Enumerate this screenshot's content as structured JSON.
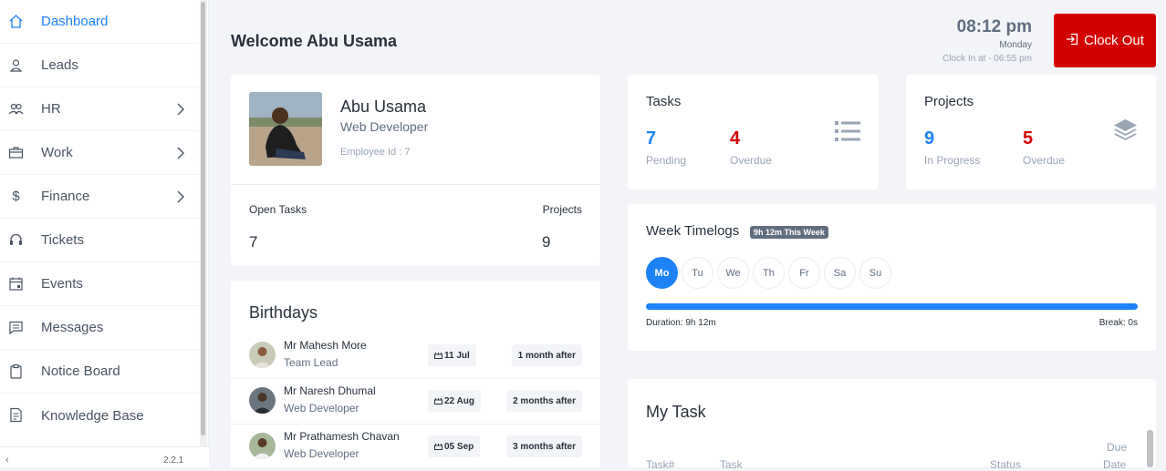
{
  "sidebar": {
    "items": [
      {
        "label": "Dashboard",
        "icon": "home-icon",
        "active": true,
        "chevron": false
      },
      {
        "label": "Leads",
        "icon": "user-icon",
        "active": false,
        "chevron": false
      },
      {
        "label": "HR",
        "icon": "users-icon",
        "active": false,
        "chevron": true
      },
      {
        "label": "Work",
        "icon": "briefcase-icon",
        "active": false,
        "chevron": true
      },
      {
        "label": "Finance",
        "icon": "dollar-icon",
        "active": false,
        "chevron": true
      },
      {
        "label": "Tickets",
        "icon": "headset-icon",
        "active": false,
        "chevron": false
      },
      {
        "label": "Events",
        "icon": "calendar-icon",
        "active": false,
        "chevron": false
      },
      {
        "label": "Messages",
        "icon": "message-icon",
        "active": false,
        "chevron": false
      },
      {
        "label": "Notice Board",
        "icon": "clipboard-icon",
        "active": false,
        "chevron": false
      },
      {
        "label": "Knowledge Base",
        "icon": "document-icon",
        "active": false,
        "chevron": false
      }
    ],
    "collapse_arrow": "‹",
    "version": "2.2.1"
  },
  "header": {
    "welcome": "Welcome Abu Usama",
    "time": "08:12 pm",
    "day": "Monday",
    "clock_in": "Clock In at - 06:55 pm",
    "clock_out_label": "Clock Out"
  },
  "profile": {
    "name": "Abu Usama",
    "role": "Web Developer",
    "employee_id": "Employee Id : 7",
    "open_tasks_label": "Open Tasks",
    "open_tasks": "7",
    "projects_label": "Projects",
    "projects": "9"
  },
  "tasks": {
    "title": "Tasks",
    "pending": "7",
    "pending_label": "Pending",
    "overdue": "4",
    "overdue_label": "Overdue"
  },
  "projects": {
    "title": "Projects",
    "in_progress": "9",
    "in_progress_label": "In Progress",
    "overdue": "5",
    "overdue_label": "Overdue"
  },
  "timelogs": {
    "title": "Week Timelogs",
    "badge": "9h 12m This Week",
    "days": [
      "Mo",
      "Tu",
      "We",
      "Th",
      "Fr",
      "Sa",
      "Su"
    ],
    "duration": "Duration: 9h 12m",
    "break": "Break: 0s",
    "progress": 1.0
  },
  "birthdays": {
    "title": "Birthdays",
    "rows": [
      {
        "name": "Mr Mahesh More",
        "role": "Team Lead",
        "date": "11 Jul",
        "after": "1 month after"
      },
      {
        "name": "Mr Naresh Dhumal",
        "role": "Web Developer",
        "date": "22 Aug",
        "after": "2 months after"
      },
      {
        "name": "Mr Prathamesh Chavan",
        "role": "Web Developer",
        "date": "05 Sep",
        "after": "3 months after"
      }
    ]
  },
  "my_task": {
    "title": "My Task",
    "headers": {
      "num": "Task#",
      "task": "Task",
      "status": "Status",
      "due1": "Due",
      "due2": "Date"
    }
  },
  "colors": {
    "primary": "#1d82f5",
    "danger": "#d30000",
    "text": "#28313c",
    "muted": "#99a5b5"
  }
}
